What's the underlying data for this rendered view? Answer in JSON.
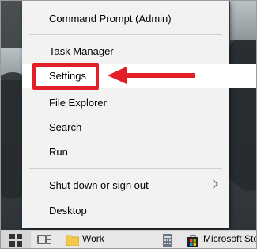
{
  "menu": {
    "items": [
      {
        "label": "Command Prompt (Admin)"
      },
      {
        "label": "Task Manager"
      },
      {
        "label": "Settings"
      },
      {
        "label": "File Explorer"
      },
      {
        "label": "Search"
      },
      {
        "label": "Run"
      },
      {
        "label": "Shut down or sign out"
      },
      {
        "label": "Desktop"
      }
    ]
  },
  "taskbar": {
    "items": [
      {
        "label": "Work"
      },
      {
        "label": "Microsoft Sto"
      }
    ]
  },
  "colors": {
    "highlight": "#e21e26",
    "menu_bg": "#f2f2f2",
    "taskbar_bg": "#e7e7e7"
  }
}
